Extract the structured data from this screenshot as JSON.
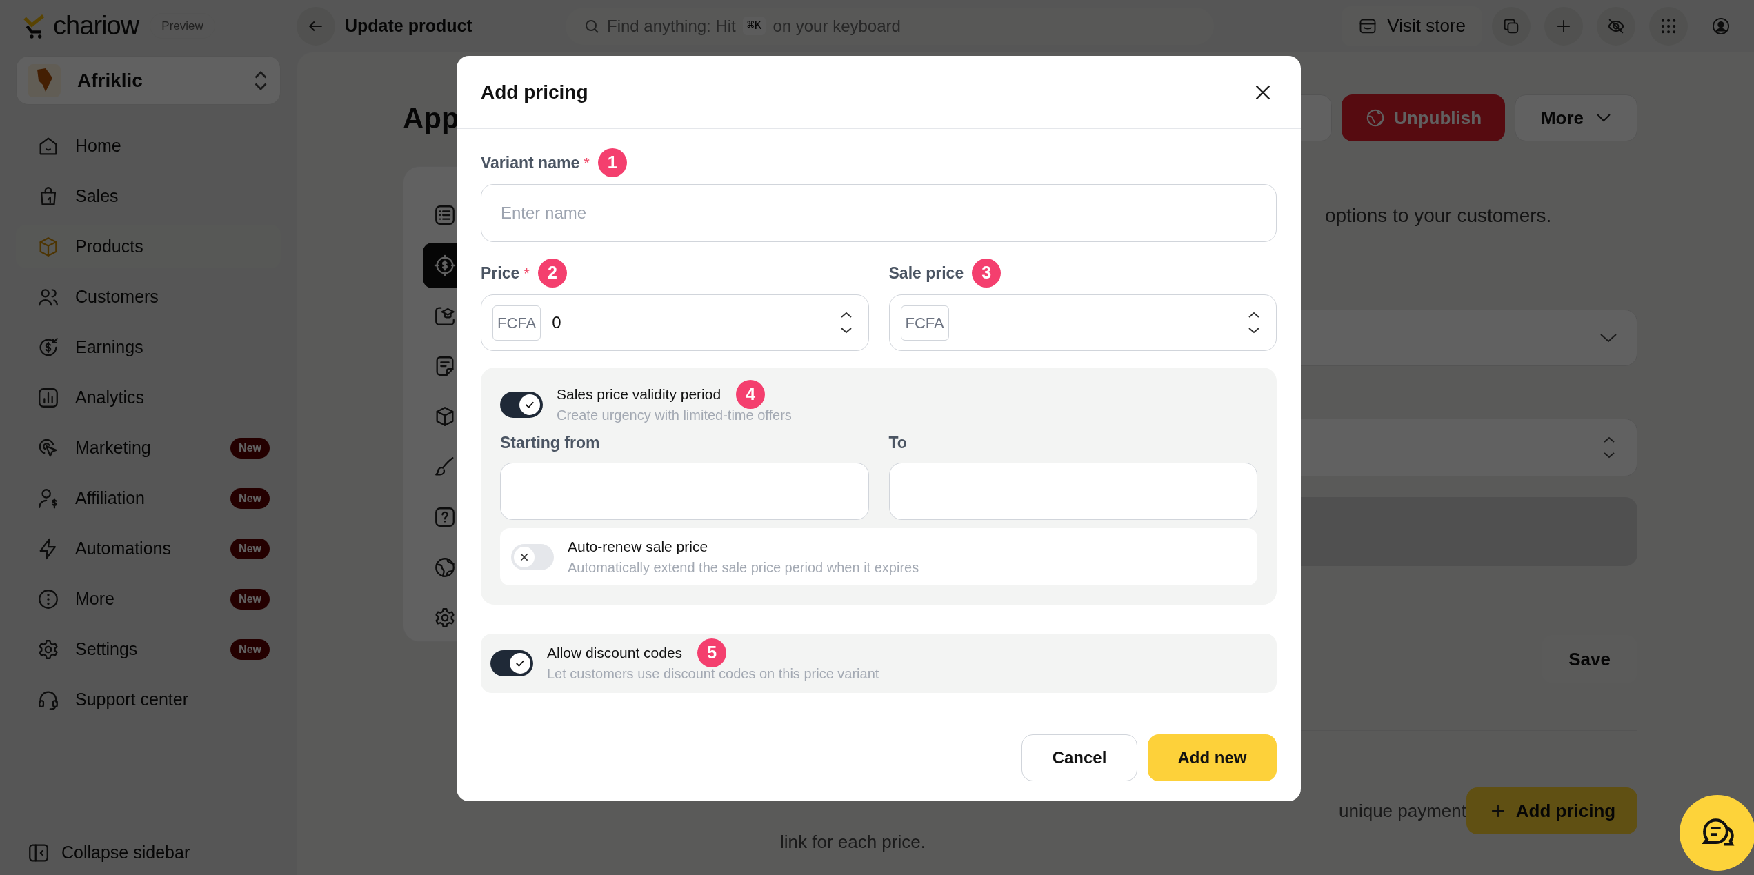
{
  "sidebar": {
    "logo": "chariow",
    "tag": "Preview",
    "workspace": "Afriklic",
    "items": [
      {
        "label": "Home",
        "selected": false
      },
      {
        "label": "Sales",
        "selected": false
      },
      {
        "label": "Products",
        "selected": true
      },
      {
        "label": "Customers",
        "selected": false
      },
      {
        "label": "Earnings",
        "selected": false
      },
      {
        "label": "Analytics",
        "selected": false
      },
      {
        "label": "Marketing",
        "selected": false,
        "badge": "New"
      },
      {
        "label": "Affiliation",
        "selected": false,
        "badge": "New"
      },
      {
        "label": "Automations",
        "selected": false,
        "badge": "New"
      },
      {
        "label": "More",
        "selected": false,
        "badge": "New"
      },
      {
        "label": "Settings",
        "selected": false,
        "badge": "New"
      },
      {
        "label": "Support center",
        "selected": false
      }
    ],
    "collapse": "Collapse sidebar"
  },
  "topbar": {
    "title": "Update product",
    "search_hint": "Find anything: Hit",
    "shortcut": "⌘K",
    "search_hint_end": "on your keyboard",
    "visit_store": "Visit store"
  },
  "page": {
    "title": "App",
    "unpublish": "Unpublish",
    "more": "More",
    "rail": [
      {
        "selected": false
      },
      {
        "selected": true
      },
      {
        "selected": false
      },
      {
        "selected": false
      },
      {
        "selected": false
      },
      {
        "selected": false
      },
      {
        "selected": false
      },
      {
        "selected": false
      },
      {
        "selected": false
      }
    ],
    "intro_visible": "options to your customers.",
    "save": "Save",
    "note_line_1_visible": "unique payment",
    "note_line_2": "link for each price.",
    "add_pricing": "Add pricing"
  },
  "dialog": {
    "title": "Add pricing",
    "variant": {
      "label": "Variant name",
      "required_mark": "*",
      "step": "1",
      "placeholder": "Enter name"
    },
    "price": {
      "label": "Price",
      "required_mark": "*",
      "step": "2",
      "currency": "FCFA",
      "value": "0"
    },
    "sale_price": {
      "label": "Sale price",
      "step": "3",
      "currency": "FCFA"
    },
    "validity": {
      "label": "Sales price validity period",
      "description": "Create urgency with limited-time offers",
      "step": "4",
      "on": true,
      "from_label": "Starting from",
      "to_label": "To",
      "auto_renew": {
        "label": "Auto-renew sale price",
        "description": "Automatically extend the sale price period when it expires",
        "on": false
      }
    },
    "discount": {
      "label": "Allow discount codes",
      "description": "Let customers use discount codes on this price variant",
      "step": "5",
      "on": true
    },
    "cancel": "Cancel",
    "submit": "Add new"
  }
}
